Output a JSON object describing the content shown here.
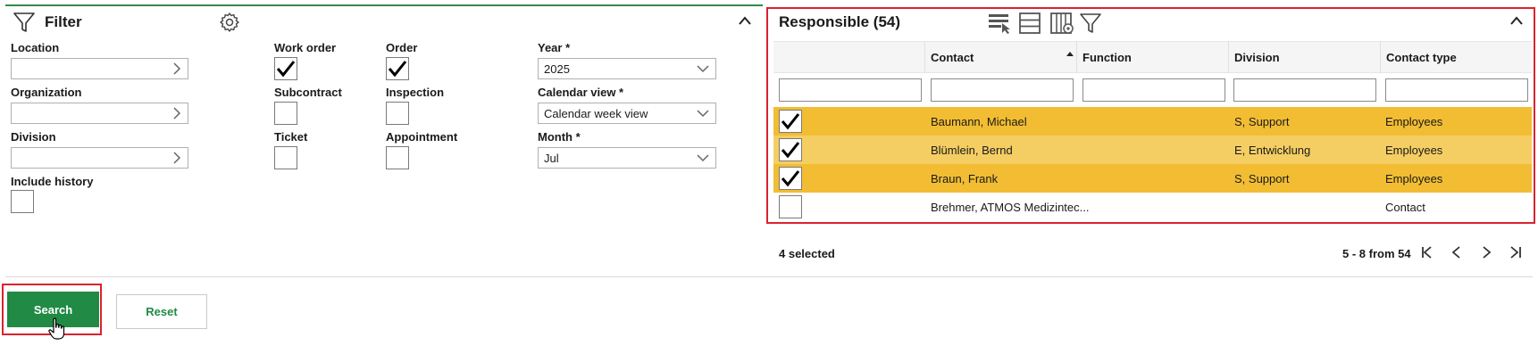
{
  "filter": {
    "title": "Filter",
    "fields": {
      "location": {
        "label": "Location",
        "value": ""
      },
      "organization": {
        "label": "Organization",
        "value": ""
      },
      "division": {
        "label": "Division",
        "value": ""
      },
      "include_history": {
        "label": "Include history",
        "checked": false
      }
    },
    "types": {
      "work_order": {
        "label": "Work order",
        "checked": true
      },
      "order": {
        "label": "Order",
        "checked": true
      },
      "subcontract": {
        "label": "Subcontract",
        "checked": false
      },
      "inspection": {
        "label": "Inspection",
        "checked": false
      },
      "ticket": {
        "label": "Ticket",
        "checked": false
      },
      "appointment": {
        "label": "Appointment",
        "checked": false
      }
    },
    "year": {
      "label": "Year *",
      "value": "2025"
    },
    "calendar_view": {
      "label": "Calendar view *",
      "value": "Calendar week view"
    },
    "month": {
      "label": "Month *",
      "value": "Jul"
    }
  },
  "responsible": {
    "title": "Responsible (54)",
    "columns": {
      "contact": "Contact",
      "function": "Function",
      "division": "Division",
      "contact_type": "Contact type"
    },
    "rows": [
      {
        "contact": "Baumann, Michael",
        "function": "",
        "division": "S, Support",
        "contact_type": "Employees",
        "checked": true
      },
      {
        "contact": "Blümlein, Bernd",
        "function": "",
        "division": "E, Entwicklung",
        "contact_type": "Employees",
        "checked": true
      },
      {
        "contact": "Braun, Frank",
        "function": "",
        "division": "S, Support",
        "contact_type": "Employees",
        "checked": true
      },
      {
        "contact": "Brehmer, ATMOS Medizintec...",
        "function": "",
        "division": "",
        "contact_type": "Contact",
        "checked": false
      }
    ],
    "selected_text": "4 selected",
    "pagination_text": "5 - 8 from 54"
  },
  "actions": {
    "search_label": "Search",
    "reset_label": "Reset"
  },
  "colors": {
    "accent_green": "#218a45",
    "row_selected": "#f2bd33",
    "row_selected_alt": "#f5ce63",
    "highlight_red": "#d9232d"
  }
}
